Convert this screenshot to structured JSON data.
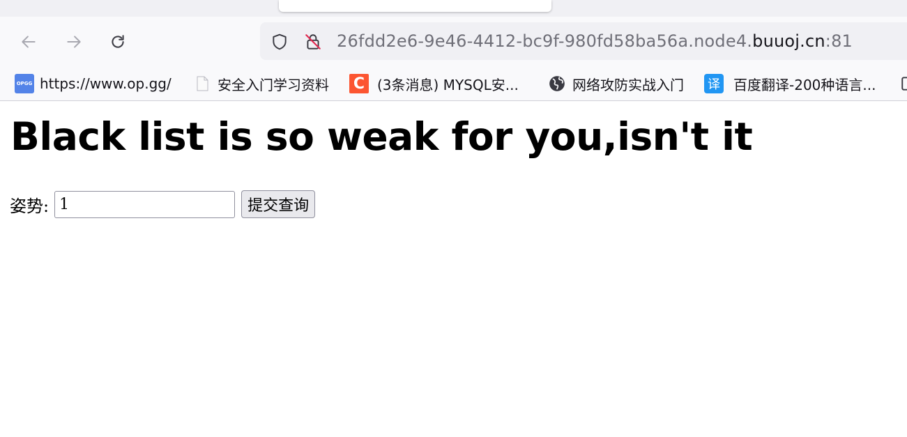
{
  "browser": {
    "url_prefix": "26fdd2e6-9e46-4412-bc9f-980fd58ba56a.node4.",
    "url_domain": "buuoj.cn",
    "url_port": ":81"
  },
  "bookmarks": [
    {
      "label": "https://www.op.gg/",
      "icon": "opgg-icon",
      "icon_text": "OPGG"
    },
    {
      "label": "安全入门学习资料",
      "icon": "page-icon"
    },
    {
      "label": "(3条消息) MYSQL安...",
      "icon": "csdn-icon",
      "icon_text": "C"
    },
    {
      "label": "网络攻防实战入门",
      "icon": "globe-icon"
    },
    {
      "label": "百度翻译-200种语言...",
      "icon": "translate-icon",
      "icon_text": "译"
    }
  ],
  "page": {
    "heading": "Black list is so weak for you,isn't it",
    "field_label": "姿势:",
    "field_value": "1",
    "submit_label": "提交查询"
  }
}
